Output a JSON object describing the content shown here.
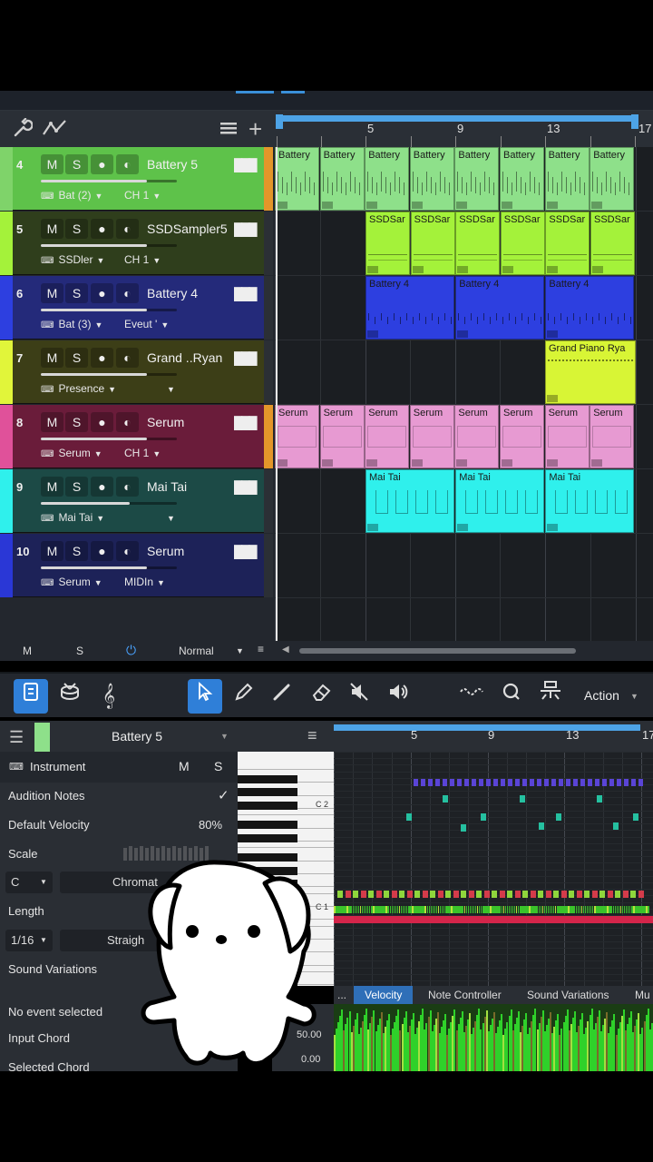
{
  "ruler": {
    "bars": [
      "5",
      "9",
      "13",
      "17"
    ]
  },
  "tracks": [
    {
      "num": "4",
      "name": "Battery 5",
      "in": "Bat (2)",
      "out": "CH 1",
      "color": "#5ec24a",
      "fill": 0.78,
      "selected": true
    },
    {
      "num": "5",
      "name": "SSDSampler5",
      "in": "SSDler",
      "out": "CH 1",
      "color": "#2f3e1c",
      "fill": 0.78
    },
    {
      "num": "6",
      "name": "Battery 4",
      "in": "Bat (3)",
      "out": "Eveut '",
      "color": "#242a7a",
      "fill": 0.78
    },
    {
      "num": "7",
      "name": "Grand ..Ryan",
      "in": "Presence",
      "out": "",
      "color": "#3c3e17",
      "fill": 0.78
    },
    {
      "num": "8",
      "name": "Serum",
      "in": "Serum",
      "out": "CH 1",
      "color": "#6a1c3a",
      "fill": 0.78
    },
    {
      "num": "9",
      "name": "Mai Tai",
      "in": "Mai Tai",
      "out": "",
      "color": "#1c4a46",
      "fill": 0.65
    },
    {
      "num": "10",
      "name": "Serum",
      "in": "Serum",
      "out": "MIDIn",
      "color": "#1d2258",
      "fill": 0.78
    }
  ],
  "track_buttons": {
    "mute": "M",
    "solo": "S"
  },
  "clips": {
    "battery5": "Battery",
    "ssd": "SSDSar",
    "battery4": "Battery 4",
    "grand": "Grand Piano Rya",
    "serum": "Serum",
    "maitai": "Mai Tai"
  },
  "arrange_bottom": {
    "m": "M",
    "s": "S",
    "mode": "Normal"
  },
  "toolbar": {
    "action": "Action"
  },
  "editor": {
    "track_name": "Battery 5",
    "bars": [
      "5",
      "9",
      "13",
      "17"
    ],
    "instrument_label": "Instrument",
    "instrument_m": "M",
    "instrument_s": "S",
    "audition_notes": "Audition Notes",
    "default_velocity_label": "Default Velocity",
    "default_velocity_value": "80%",
    "scale_label": "Scale",
    "scale_root": "C",
    "scale_type": "Chromat",
    "length_label": "Length",
    "length_value": "1/16",
    "length_mode": "Straigh",
    "sound_variations_label": "Sound Variations",
    "no_event": "No event selected",
    "input_chord": "Input Chord",
    "selected_chord": "Selected Chord",
    "key_c2": "C 2",
    "key_c1": "C 1"
  },
  "lanes": {
    "more": "...",
    "velocity": "Velocity",
    "note_controller": "Note Controller",
    "sound_variations": "Sound Variations",
    "mu": "Mu",
    "scale_mid": "50.00",
    "scale_low": "0.00"
  },
  "colors": {
    "battery5": "#8ee08a",
    "ssd": "#a4f23a",
    "battery4": "#2d3fe0",
    "grand": "#d8f535",
    "serum": "#e79ad2",
    "maitai": "#2ff0ec",
    "accent": "#2f7fd8"
  }
}
